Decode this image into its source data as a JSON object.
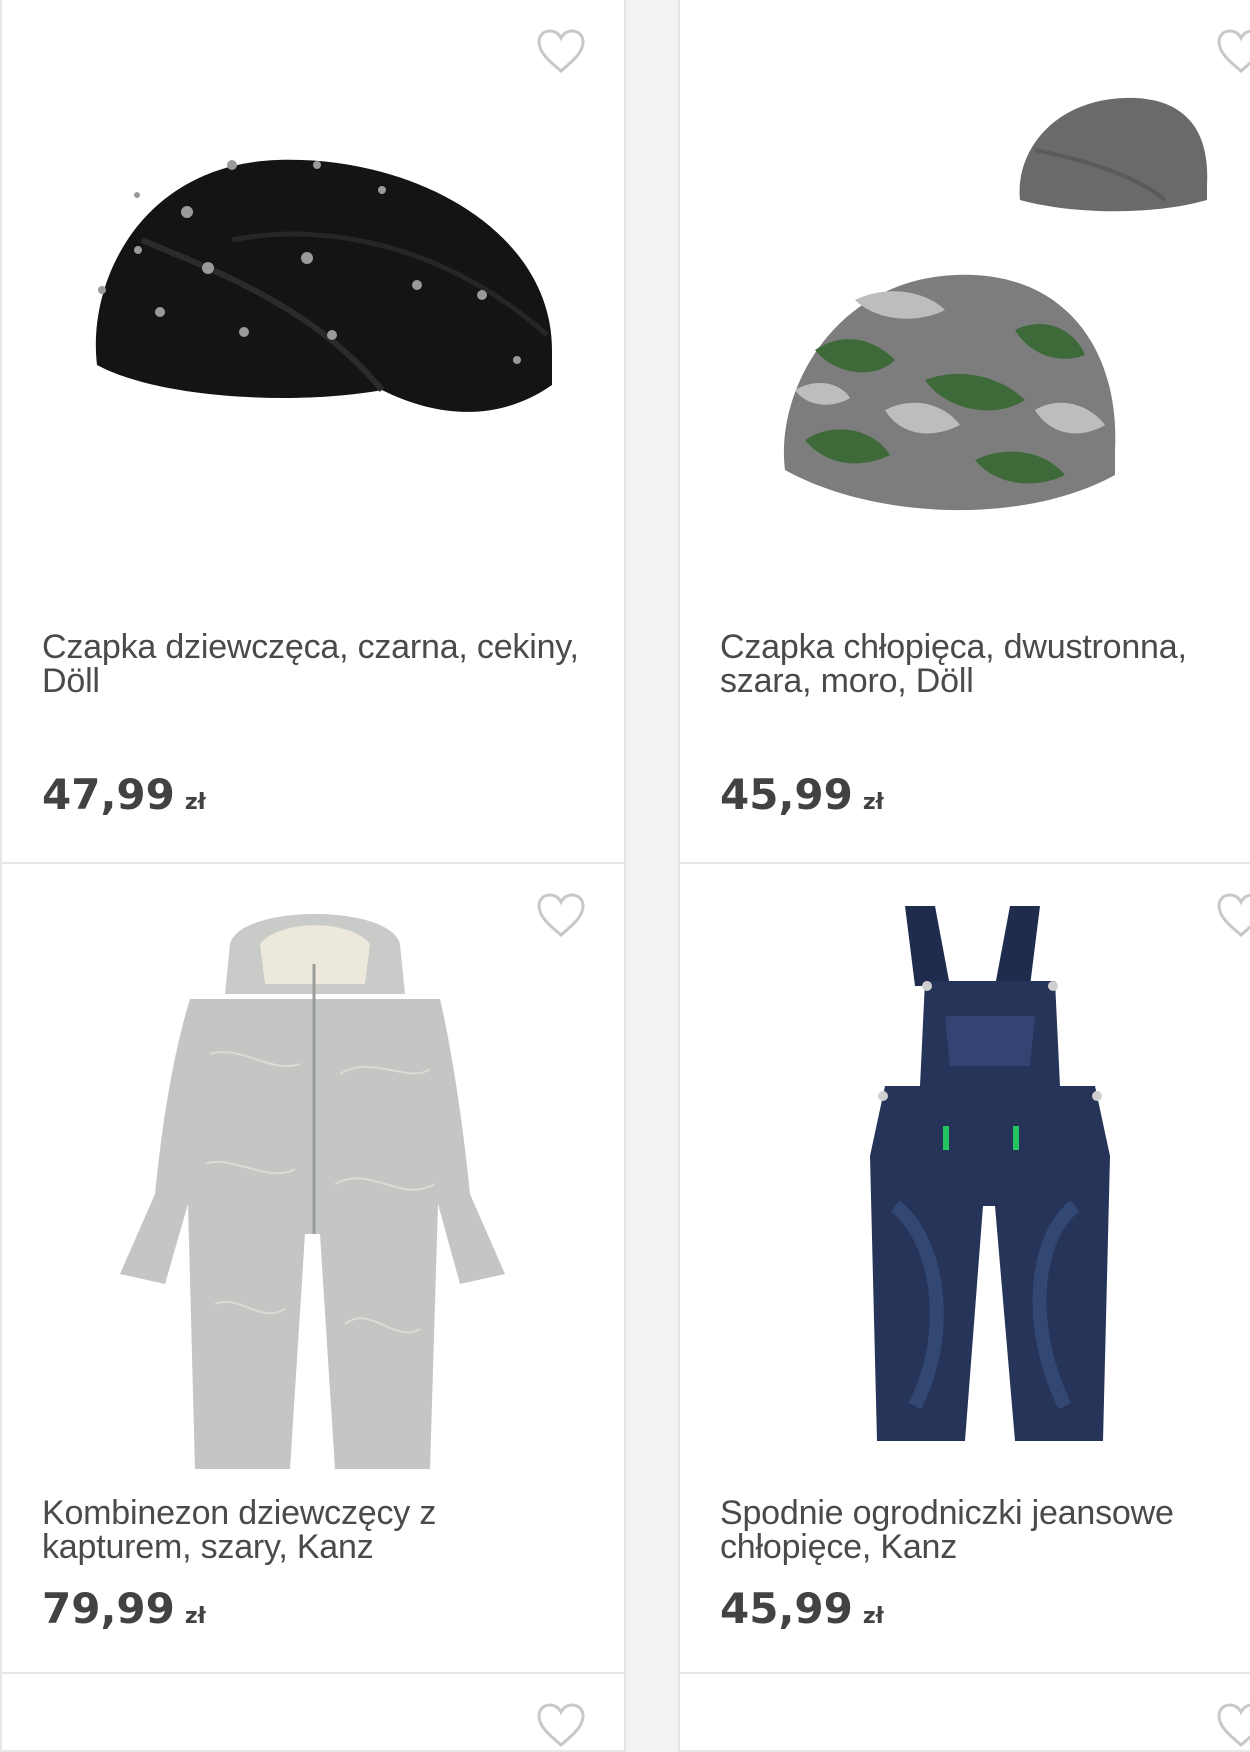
{
  "products": [
    {
      "title": "Czapka dziewczęca, czarna, cekiny, Döll",
      "price": "47,99",
      "currency": "zł",
      "icon": "heart-outline-icon"
    },
    {
      "title": "Czapka chłopięca, dwustronna, szara, moro, Döll",
      "price": "45,99",
      "currency": "zł",
      "icon": "heart-outline-icon"
    },
    {
      "title": "Kombinezon dziewczęcy z kapturem, szary, Kanz",
      "price": "79,99",
      "currency": "zł",
      "icon": "heart-outline-icon"
    },
    {
      "title": "Spodnie ogrodniczki jeansowe chłopięce, Kanz",
      "price": "45,99",
      "currency": "zł",
      "icon": "heart-outline-icon"
    }
  ],
  "colors": {
    "background": "#f2f2f2",
    "card": "#ffffff",
    "text": "#4a4a4a",
    "price": "#424242",
    "heart": "#c8c8c8"
  }
}
